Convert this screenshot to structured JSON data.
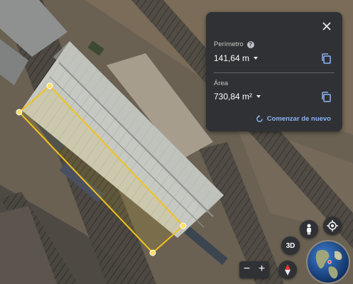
{
  "panel": {
    "perimeter_label": "Perímetro",
    "perimeter_value": "141,64 m",
    "area_label": "Área",
    "area_value": "730,84 m²",
    "restart_label": "Comenzar de nuevo"
  },
  "controls": {
    "btn_3d_label": "3D",
    "zoom_out_label": "−",
    "zoom_in_label": "+"
  },
  "icons": {
    "close": "close-icon",
    "help": "help-icon",
    "copy": "copy-icon",
    "restart": "restart-icon",
    "pegman": "pegman-icon",
    "location": "my-location-icon",
    "compass": "compass-icon",
    "globe": "globe-icon"
  },
  "colors": {
    "panel_bg": "#303134",
    "accent": "#8ab4f8",
    "measure_line": "#f2c21b"
  }
}
